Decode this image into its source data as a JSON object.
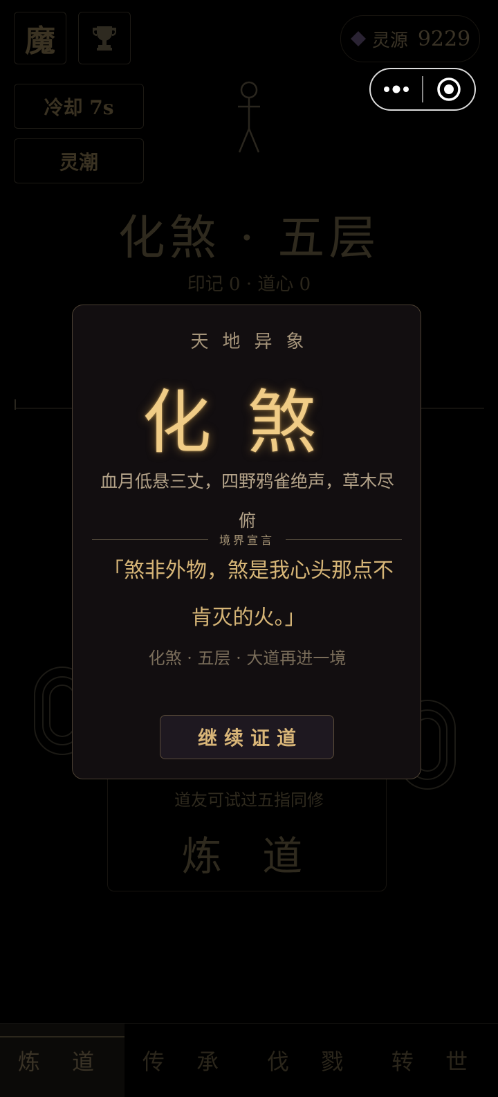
{
  "top_left": {
    "mode_badge": "魔",
    "trophy_icon": "trophy-icon"
  },
  "buttons": {
    "cooldown": "冷却 7s",
    "tide": "灵潮"
  },
  "resource": {
    "icon": "diamond-icon",
    "label": "灵源",
    "value": "9229"
  },
  "realm": {
    "title": "化煞 · 五层",
    "stats": "印记 0 · 道心 0"
  },
  "cultivate": {
    "hint": "道友可试过五指同修",
    "label": "炼 道"
  },
  "tabs": [
    "炼 道",
    "传 承",
    "伐 戮",
    "转 世"
  ],
  "active_tab": 0,
  "modal": {
    "eyebrow": "天地异象",
    "realm_name": "化煞",
    "description": "血月低悬三丈，四野鸦雀绝声，草木尽俯",
    "declaration_label": "境界宣言",
    "quote": "「煞非外物，煞是我心头那点不肯灭的火。」",
    "footnote": "化煞 · 五层 · 大道再进一境",
    "continue_label": "继续证道"
  },
  "colors": {
    "gold": "#f0cc86",
    "modal_bg": "#120e10",
    "border": "#4d4234"
  }
}
